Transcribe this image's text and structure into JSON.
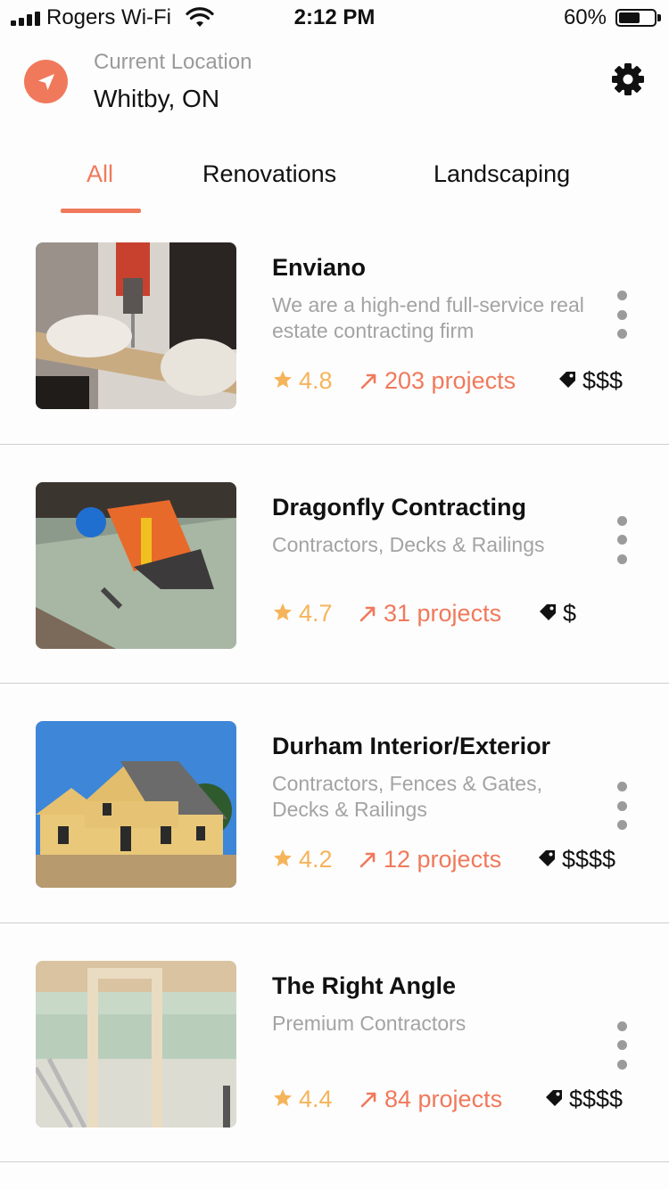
{
  "status_bar": {
    "carrier": "Rogers Wi-Fi",
    "time": "2:12 PM",
    "battery": "60%",
    "battery_level": 0.6
  },
  "header": {
    "location_label": "Current Location",
    "location_value": "Whitby, ON",
    "location_icon": "navigation-arrow-icon",
    "settings_icon": "gear-icon"
  },
  "tabs": [
    {
      "label": "All",
      "active": true
    },
    {
      "label": "Renovations",
      "active": false
    },
    {
      "label": "Landscaping",
      "active": false
    }
  ],
  "colors": {
    "accent": "#f0795b",
    "rating": "#f6b45a",
    "muted": "#a3a3a3"
  },
  "contractors": [
    {
      "name": "Enviano",
      "description": "We are a high-end full-service real estate contracting firm",
      "rating": "4.8",
      "projects": "203 projects",
      "price": "$$$",
      "image": "drill-worker-photo"
    },
    {
      "name": "Dragonfly Contracting",
      "description": "Contractors, Decks & Railings",
      "rating": "4.7",
      "projects": "31 projects",
      "price": "$",
      "image": "roofer-hammer-photo"
    },
    {
      "name": "Durham Interior/Exterior",
      "description": "Contractors, Fences & Gates, Decks & Railings",
      "rating": "4.2",
      "projects": "12 projects",
      "price": "$$$$",
      "image": "house-frame-photo"
    },
    {
      "name": "The Right Angle",
      "description": "Premium Contractors",
      "rating": "4.4",
      "projects": "84 projects",
      "price": "$$$$",
      "image": "interior-doorframe-photo"
    }
  ]
}
